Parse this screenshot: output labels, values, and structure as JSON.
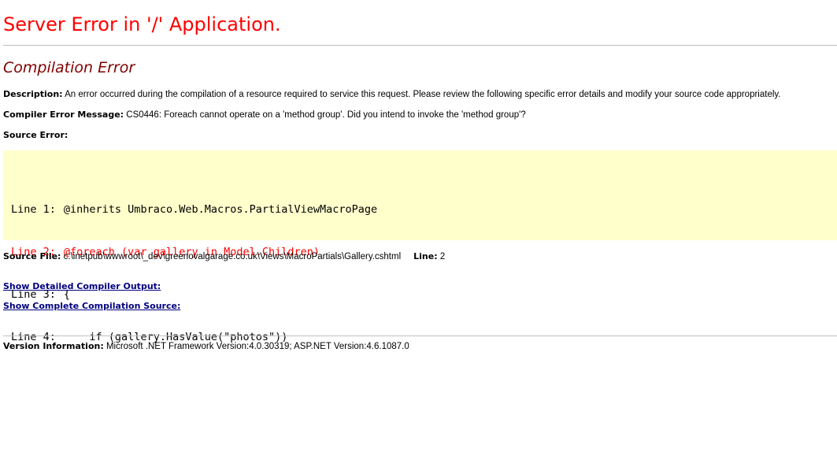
{
  "page": {
    "title": "Server Error in '/' Application.",
    "subtitle": "Compilation Error"
  },
  "description": {
    "label": "Description:",
    "text": "An error occurred during the compilation of a resource required to service this request. Please review the following specific error details and modify your source code appropriately."
  },
  "compiler_error": {
    "label": "Compiler Error Message:",
    "text": "CS0446: Foreach cannot operate on a 'method group'. Did you intend to invoke the 'method group'?"
  },
  "source_error": {
    "label": "Source Error:",
    "lines": [
      {
        "number": "Line 1:",
        "code": "@inherits Umbraco.Web.Macros.PartialViewMacroPage",
        "is_error": false
      },
      {
        "number": "Line 2:",
        "code": "@foreach (var gallery in Model.Children)",
        "is_error": true
      },
      {
        "number": "Line 3:",
        "code": "{",
        "is_error": false
      },
      {
        "number": "Line 4:",
        "code": "    if (gallery.HasValue(\"photos\"))",
        "is_error": false
      }
    ]
  },
  "source_file": {
    "label": "Source File:",
    "path": "c:\\inetpub\\wwwroot\\_dev\\greenovalgarage.co.uk\\Views\\MacroPartials\\Gallery.cshtml",
    "line_label": "Line:",
    "line_value": "2"
  },
  "links": {
    "detailed_output": "Show Detailed Compiler Output:",
    "complete_source": "Show Complete Compilation Source:"
  },
  "version": {
    "label": "Version Information:",
    "text": "Microsoft .NET Framework Version:4.0.30319; ASP.NET Version:4.6.1087.0"
  },
  "colors": {
    "title": "#ff0000",
    "subtitle": "#800000",
    "code_background": "#ffffcc",
    "error_line": "#ff0000",
    "link": "#000080"
  }
}
